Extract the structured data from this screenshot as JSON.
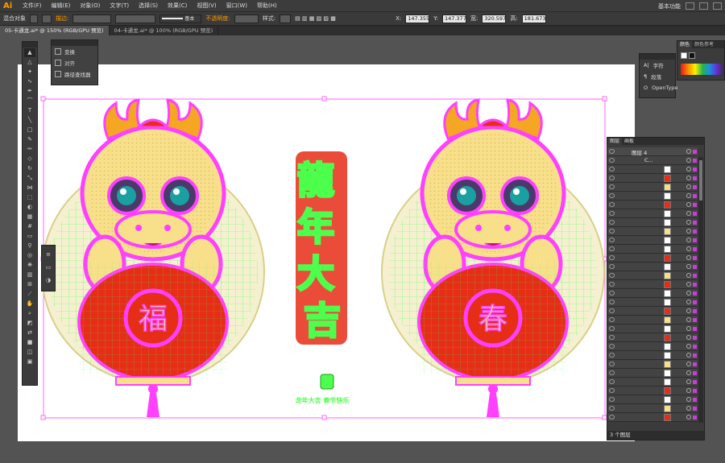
{
  "app": {
    "logo": "Ai"
  },
  "menubar": {
    "items": [
      "文件(F)",
      "编辑(E)",
      "对象(O)",
      "文字(T)",
      "选择(S)",
      "效果(C)",
      "视图(V)",
      "窗口(W)",
      "帮助(H)"
    ],
    "workspace": "基本功能"
  },
  "control_bar": {
    "selection_label": "混合对象",
    "stroke_label": "描边:",
    "stroke_style": "基本",
    "opacity_label": "不透明度:",
    "style_label": "样式:",
    "x_value": "147.355",
    "y_value": "147.377",
    "w_value": "320.597",
    "h_value": "181.673"
  },
  "tabs": [
    {
      "label": "05-卡通龙.ai* @ 150% (RGB/GPU 预览)",
      "active": true
    },
    {
      "label": "04-卡通龙.ai* @ 100% (RGB/GPU 预览)",
      "active": false
    }
  ],
  "align_popup": {
    "items": [
      "变换",
      "对齐",
      "路径查找器"
    ]
  },
  "color_panel": {
    "tab_color": "颜色",
    "tab_guide": "颜色参考"
  },
  "char_panel": {
    "items": [
      "字符",
      "段落",
      "OpenType"
    ]
  },
  "layers_panel": {
    "tab_layers": "图层",
    "tab_artboards": "画板",
    "top_layer": "图层 4",
    "sub_layer": "C...",
    "footer": "3 个图层"
  },
  "artwork": {
    "left_medallion_char": "福",
    "right_medallion_char": "春",
    "center_vertical_text": "龍年大吉",
    "caption_line": "龙年大吉 春节快乐"
  },
  "colors": {
    "selection": "#ff40ff",
    "anchor": "#4dff4d",
    "dragon_yellow": "#f8e08a",
    "lantern_red": "#e62d16",
    "panel_bg": "#3b3b3b",
    "app_bg": "#535353"
  }
}
